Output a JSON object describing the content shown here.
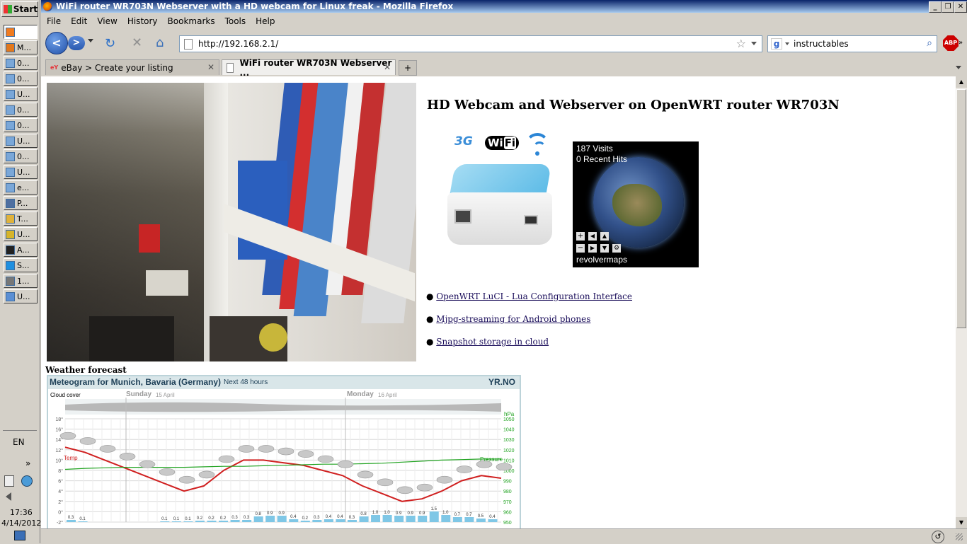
{
  "taskbar": {
    "start_label": "Start",
    "items": [
      "",
      "M...",
      "0...",
      "0...",
      "U...",
      "0...",
      "0...",
      "U...",
      "0...",
      "U...",
      "e...",
      "P...",
      "T...",
      "U...",
      "A...",
      "S...",
      "1...",
      "U..."
    ],
    "language": "EN",
    "clock_time": "17:36",
    "clock_date": "4/14/2012",
    "expand_label": "»"
  },
  "window": {
    "title": "WiFi router WR703N Webserver with a HD webcam for Linux freak - Mozilla Firefox"
  },
  "menubar": [
    "File",
    "Edit",
    "View",
    "History",
    "Bookmarks",
    "Tools",
    "Help"
  ],
  "navbar": {
    "url": "http://192.168.2.1/",
    "search_engine_letter": "g",
    "search_value": "instructables",
    "abp_label": "ABP"
  },
  "tabs": [
    {
      "label": "eBay > Create your listing",
      "favicon": "eBay"
    },
    {
      "label": "WiFi router WR703N Webserver ...",
      "favicon": "page"
    }
  ],
  "page": {
    "heading": "HD Webcam and Webserver on OpenWRT router WR703N",
    "badges": [
      "3G",
      "Wi",
      "Fi"
    ],
    "globe": {
      "visits": "187 Visits",
      "recent": "0 Recent Hits",
      "brand": "revolvermaps"
    },
    "links": [
      "OpenWRT LuCI - Lua Configuration Interface",
      "Mjpg-streaming for Android phones",
      "Snapshot storage in cloud"
    ],
    "weather_heading": "Weather forecast",
    "meteogram": {
      "title": "Meteogram for Munich, Bavaria (Germany)",
      "subtitle": "Next 48 hours",
      "brand": "YR.NO",
      "cloud_label": "Cloud cover",
      "day1": "Sunday",
      "day1_date": "15 April",
      "day2": "Monday",
      "day2_date": "16 April",
      "temp_label": "Temp",
      "pressure_label": "Pressure",
      "hpa_label": "hPa"
    }
  },
  "chart_data": {
    "type": "line",
    "title": "Meteogram for Munich, Bavaria (Germany)",
    "subtitle": "Next 48 hours",
    "temp_ticks": [
      "18°",
      "16°",
      "14°",
      "12°",
      "10°",
      "8°",
      "6°",
      "4°",
      "2°",
      "0°",
      "-2°"
    ],
    "pressure_ticks": [
      "1050",
      "1040",
      "1030",
      "1020",
      "1010",
      "1000",
      "990",
      "980",
      "970",
      "960",
      "950"
    ],
    "ylim_temp": [
      -2,
      18
    ],
    "ylim_pressure": [
      950,
      1050
    ],
    "series": [
      {
        "name": "Temp",
        "color": "#d02020",
        "values": [
          12.5,
          11.5,
          10,
          8.5,
          7,
          5.5,
          4,
          5,
          8,
          10,
          10,
          9.5,
          9,
          8,
          7,
          5,
          3.5,
          2,
          2.5,
          4,
          6,
          7,
          6.5
        ]
      },
      {
        "name": "Pressure",
        "color": "#21a321",
        "values": [
          1001,
          1002,
          1002.5,
          1003,
          1003,
          1003,
          1003,
          1003.5,
          1004,
          1004,
          1004.5,
          1005,
          1005.5,
          1006,
          1006,
          1006.5,
          1007,
          1008,
          1009,
          1010,
          1010.5,
          1011,
          1011
        ]
      }
    ],
    "precip_labels": [
      "0.3",
      "0.1",
      "",
      "",
      "",
      "",
      "",
      "",
      "0.1",
      "0.1",
      "0.1",
      "0.2",
      "0.2",
      "0.2",
      "0.3",
      "0.3",
      "0.8",
      "0.9",
      "0.9",
      "0.4",
      "0.2",
      "0.3",
      "0.4",
      "0.4",
      "0.3",
      "0.8",
      "1.0",
      "1.0",
      "0.9",
      "0.9",
      "0.9",
      "1.5",
      "1.0",
      "0.7",
      "0.7",
      "0.5",
      "0.4"
    ]
  },
  "status": {}
}
